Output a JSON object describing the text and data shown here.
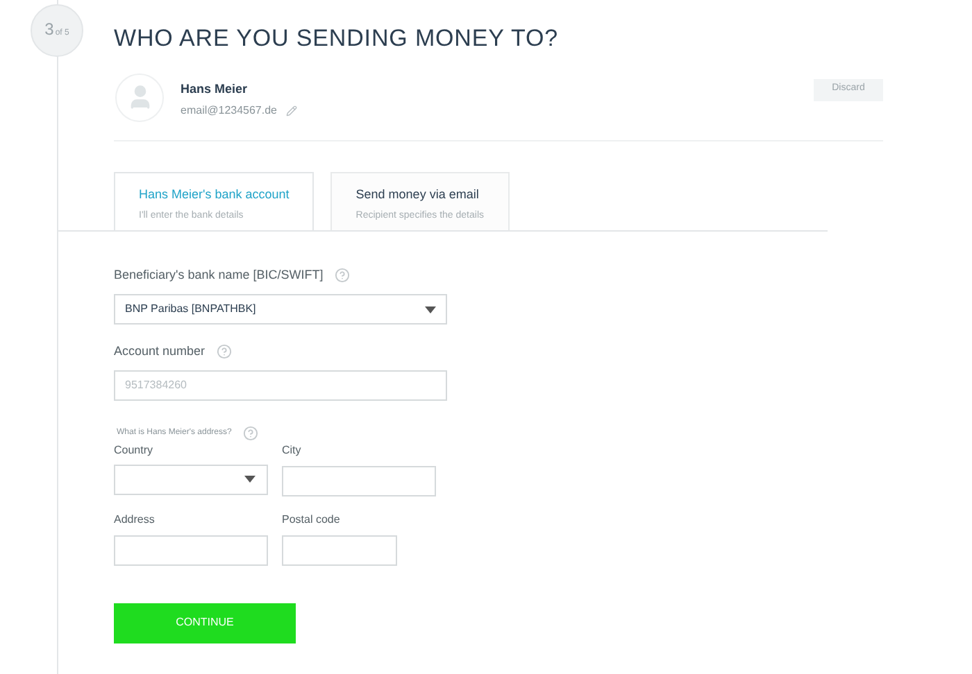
{
  "step": {
    "current": "3",
    "total": "of 5"
  },
  "title": "WHO ARE YOU SENDING MONEY TO?",
  "recipient": {
    "name": "Hans Meier",
    "email": "email@1234567.de"
  },
  "discard_button": "Discard",
  "tabs": [
    {
      "label": "Hans Meier's bank account",
      "sublabel": "I'll enter the bank details",
      "selected": true
    },
    {
      "label": "Send money via email",
      "sublabel": "Recipient specifies the details",
      "selected": false
    }
  ],
  "bank": {
    "label": "Beneficiary's bank name [BIC/SWIFT]",
    "value": "BNP Paribas [BNPATHBK]"
  },
  "account": {
    "label": "Account number",
    "placeholder": "9517384260"
  },
  "address_question": "What is Hans Meier's address?",
  "address_fields": [
    {
      "label": "Country",
      "kind": "select"
    },
    {
      "label": "City",
      "kind": "input"
    },
    {
      "label": "Address",
      "kind": "input"
    },
    {
      "label": "Postal code",
      "kind": "input"
    }
  ],
  "continue_button": "CONTINUE"
}
